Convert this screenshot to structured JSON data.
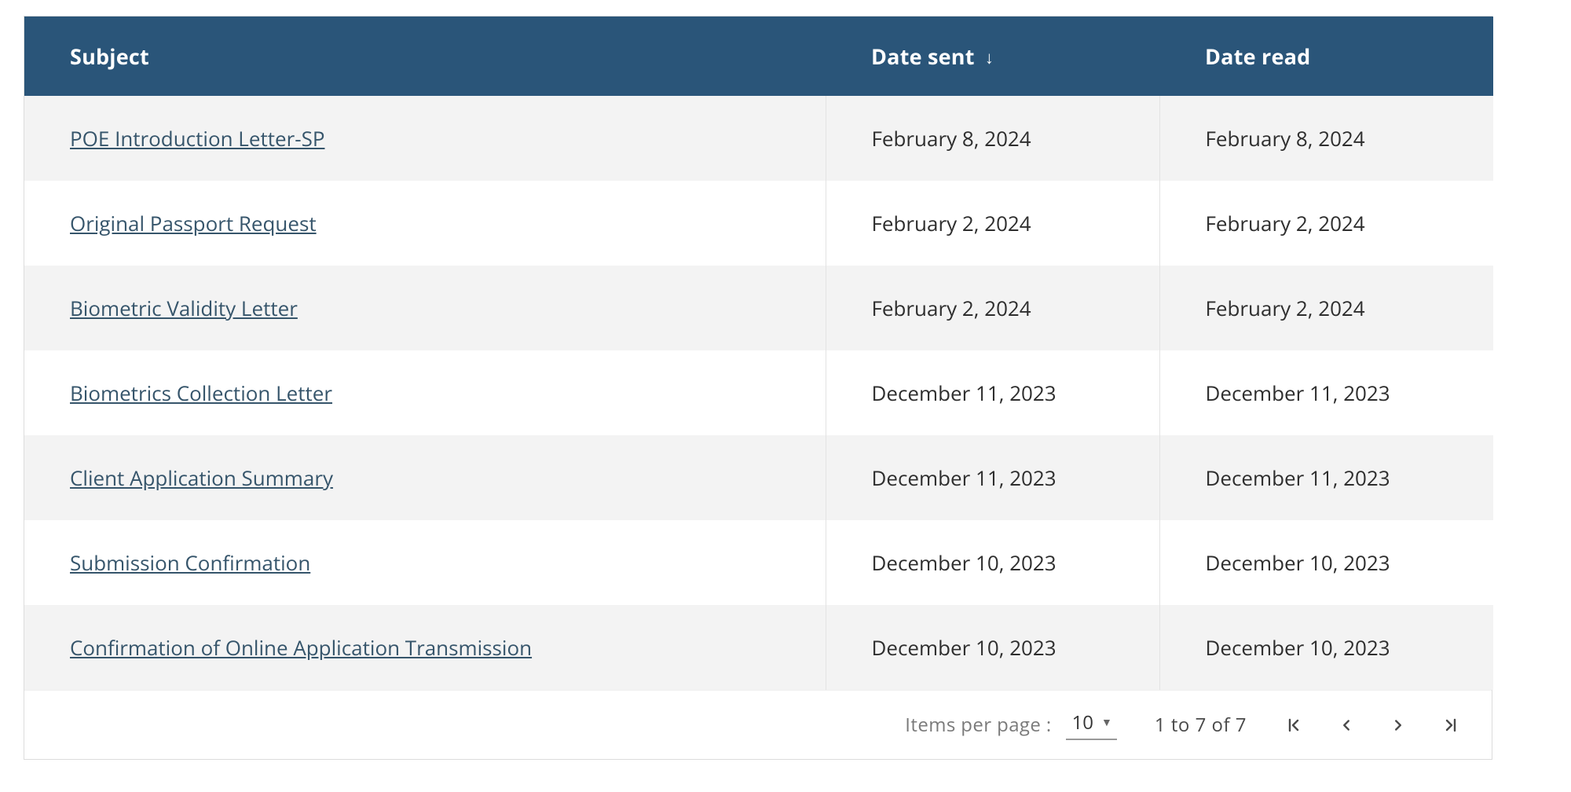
{
  "table": {
    "headers": {
      "subject": "Subject",
      "date_sent": "Date sent",
      "date_read": "Date read"
    },
    "sort": {
      "column": "date_sent",
      "direction_glyph": "↓"
    },
    "rows": [
      {
        "subject": "POE Introduction Letter-SP",
        "date_sent": "February 8, 2024",
        "date_read": "February 8, 2024"
      },
      {
        "subject": "Original Passport Request",
        "date_sent": "February 2, 2024",
        "date_read": "February 2, 2024"
      },
      {
        "subject": "Biometric Validity Letter",
        "date_sent": "February 2, 2024",
        "date_read": "February 2, 2024"
      },
      {
        "subject": "Biometrics Collection Letter",
        "date_sent": "December 11, 2023",
        "date_read": "December 11, 2023"
      },
      {
        "subject": "Client Application Summary",
        "date_sent": "December 11, 2023",
        "date_read": "December 11, 2023"
      },
      {
        "subject": "Submission Confirmation",
        "date_sent": "December 10, 2023",
        "date_read": "December 10, 2023"
      },
      {
        "subject": "Confirmation of Online Application Transmission",
        "date_sent": "December 10, 2023",
        "date_read": "December 10, 2023"
      }
    ]
  },
  "pager": {
    "items_per_page_label": "Items per page :",
    "items_per_page_value": "10",
    "range_text": "1 to 7 of 7"
  }
}
